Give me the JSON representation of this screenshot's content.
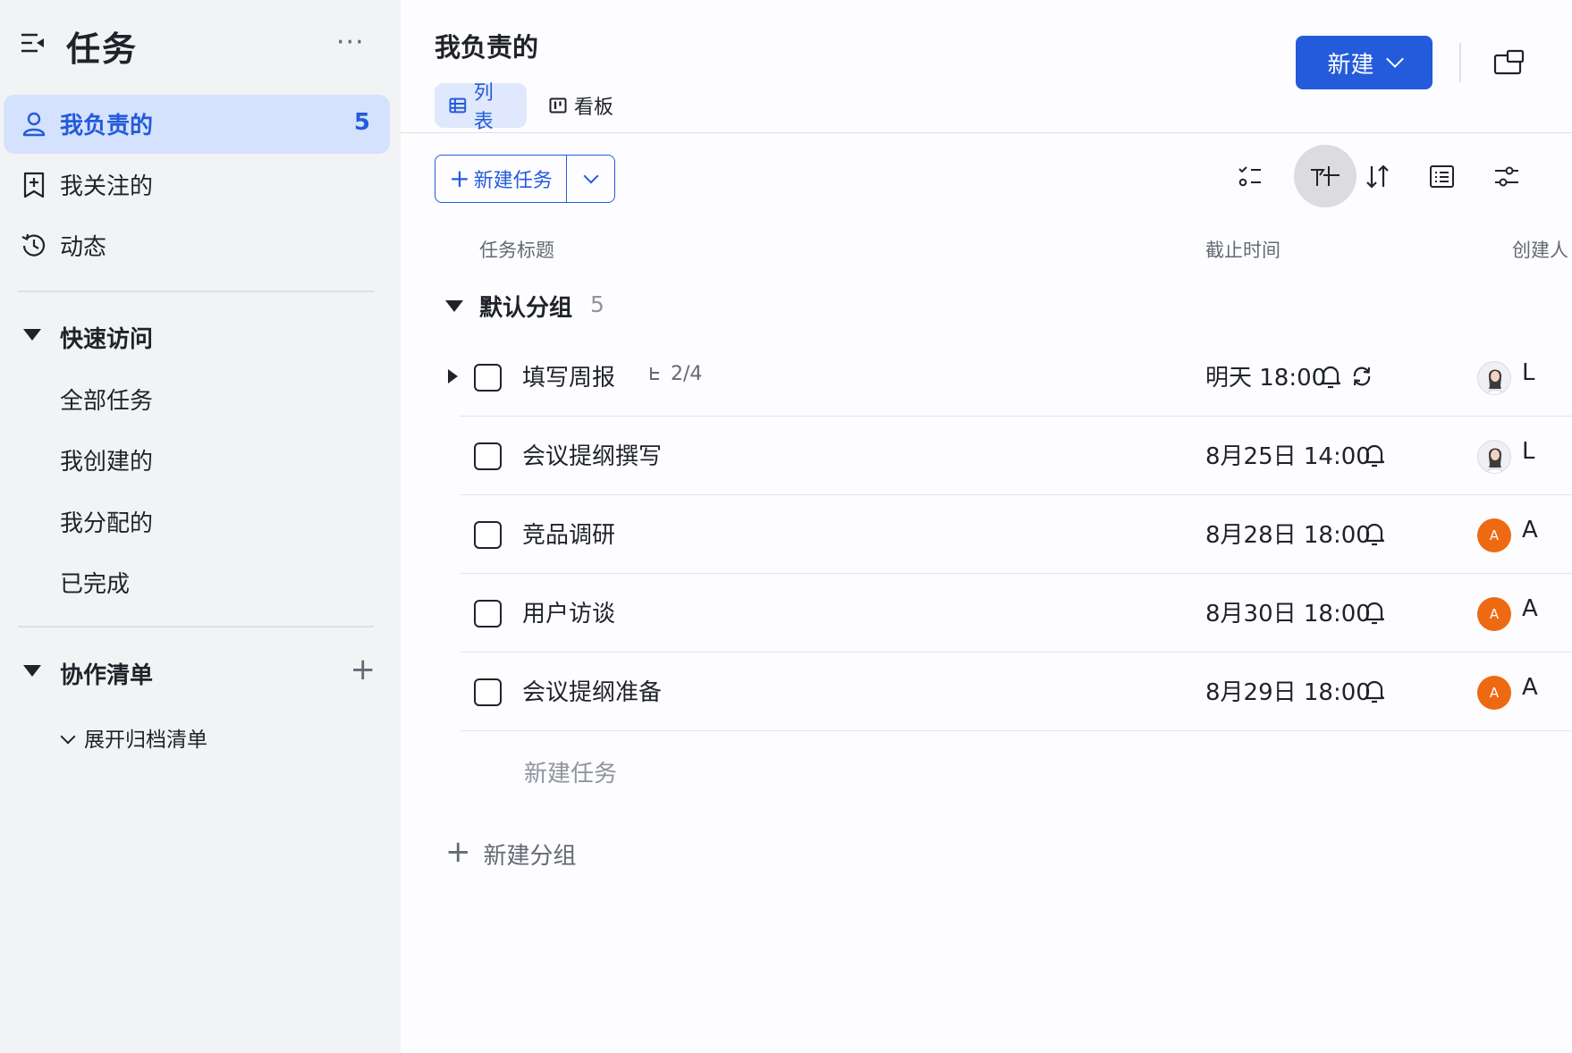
{
  "sidebar": {
    "title": "任务",
    "more": "···",
    "nav": [
      {
        "label": "我负责的",
        "count": "5",
        "active": true,
        "icon": "person-icon"
      },
      {
        "label": "我关注的",
        "icon": "bookmark-icon"
      },
      {
        "label": "动态",
        "icon": "history-icon"
      }
    ],
    "quick_access": {
      "title": "快速访问",
      "items": [
        "全部任务",
        "我创建的",
        "我分配的",
        "已完成"
      ]
    },
    "collab": {
      "title": "协作清单",
      "add": "+",
      "expand_archived": "展开归档清单"
    }
  },
  "header": {
    "title": "我负责的",
    "tabs": [
      {
        "label": "列表",
        "active": true,
        "icon": "list-table-icon"
      },
      {
        "label": "看板",
        "active": false,
        "icon": "kanban-icon"
      }
    ],
    "new_button": "新建"
  },
  "toolbar": {
    "new_task": "新建任务",
    "plus": "+"
  },
  "columns": {
    "title": "任务标题",
    "due": "截止时间",
    "creator": "创建人"
  },
  "group": {
    "name": "默认分组",
    "count": "5"
  },
  "tasks": [
    {
      "title": "填写周报",
      "subtasks": "2/4",
      "due": "明天 18:00",
      "reminder": true,
      "repeat": true,
      "creator": "L",
      "avatar": "photo"
    },
    {
      "title": "会议提纲撰写",
      "due": "8月25日 14:00",
      "reminder": true,
      "creator": "L",
      "avatar": "photo"
    },
    {
      "title": "竞品调研",
      "due": "8月28日 18:00",
      "reminder": true,
      "creator": "A",
      "avatar": "orange",
      "avatar_text": "A"
    },
    {
      "title": "用户访谈",
      "due": "8月30日 18:00",
      "reminder": true,
      "creator": "A",
      "avatar": "orange",
      "avatar_text": "A"
    },
    {
      "title": "会议提纲准备",
      "due": "8月29日 18:00",
      "reminder": true,
      "creator": "A",
      "avatar": "orange",
      "avatar_text": "A"
    }
  ],
  "inline_new_task": "新建任务",
  "new_group": "新建分组",
  "colors": {
    "accent": "#245bdb",
    "sidebar_active_bg": "#d5e2fd",
    "avatar_orange": "#ee6a12"
  }
}
